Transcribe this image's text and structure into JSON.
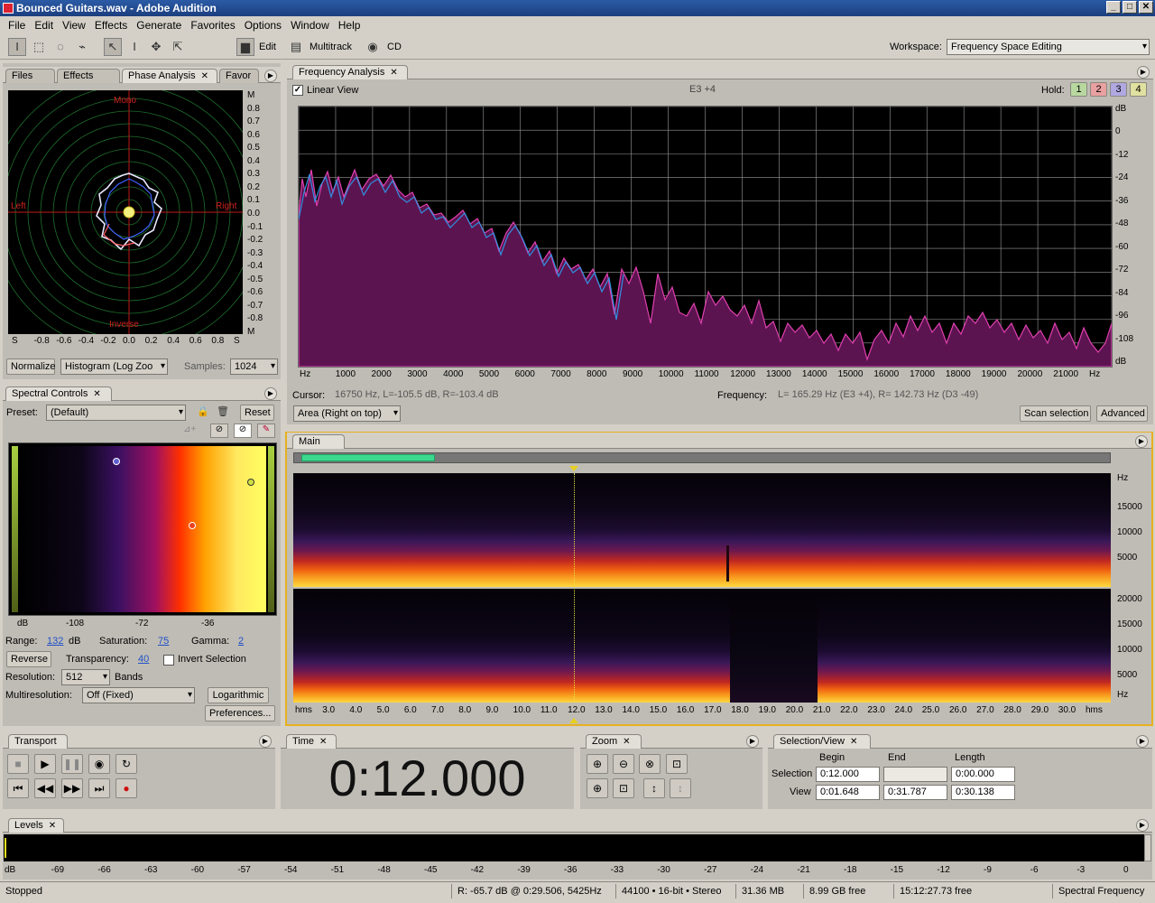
{
  "window": {
    "title": "Bounced Guitars.wav - Adobe Audition",
    "min": "_",
    "max": "□",
    "close": "✕"
  },
  "menu": [
    "File",
    "Edit",
    "View",
    "Effects",
    "Generate",
    "Favorites",
    "Options",
    "Window",
    "Help"
  ],
  "toolbar": {
    "edit": "Edit",
    "multitrack": "Multitrack",
    "cd": "CD",
    "workspace_label": "Workspace:",
    "workspace_value": "Frequency Space Editing"
  },
  "left_tabs": [
    "Files",
    "Effects",
    "Phase Analysis",
    "Favor"
  ],
  "phase": {
    "mono": "Mono",
    "inverse": "Inverse",
    "left": "Left",
    "right": "Right",
    "yticks": [
      "M",
      "0.8",
      "0.7",
      "0.6",
      "0.5",
      "0.4",
      "0.3",
      "0.2",
      "0.1",
      "0.0",
      "-0.1",
      "-0.2",
      "-0.3",
      "-0.4",
      "-0.5",
      "-0.6",
      "-0.7",
      "-0.8",
      "M"
    ],
    "xticks": [
      "S",
      "-0.8",
      "-0.6",
      "-0.4",
      "-0.2",
      "0.0",
      "0.2",
      "0.4",
      "0.6",
      "0.8",
      "S"
    ],
    "normalize": "Normalize",
    "histogram": "Histogram (Log Zoo",
    "samples_label": "Samples:",
    "samples": "1024"
  },
  "spectral": {
    "tab": "Spectral Controls",
    "preset_label": "Preset:",
    "preset": "(Default)",
    "reset": "Reset",
    "ticks": [
      "dB",
      "-108",
      "-72",
      "-36"
    ],
    "range_label": "Range:",
    "range": "132",
    "range_unit": "dB",
    "sat_label": "Saturation:",
    "sat": "75",
    "gamma_label": "Gamma:",
    "gamma": "2",
    "reverse": "Reverse",
    "transp_label": "Transparency:",
    "transp": "40",
    "invert": "Invert Selection",
    "res_label": "Resolution:",
    "res": "512",
    "bands": "Bands",
    "multires_label": "Multiresolution:",
    "multires": "Off (Fixed)",
    "log": "Logarithmic",
    "prefs": "Preferences..."
  },
  "freq": {
    "tab": "Frequency Analysis",
    "linear": "Linear View",
    "note": "E3 +4",
    "hold": "Hold:",
    "holds": [
      "1",
      "2",
      "3",
      "4"
    ],
    "hold_colors": [
      "#b8d8a0",
      "#e8a0a0",
      "#b0a8e0",
      "#e0e0a0"
    ],
    "dbticks": [
      "dB",
      "0",
      "-12",
      "-24",
      "-36",
      "-48",
      "-60",
      "-72",
      "-84",
      "-96",
      "-108",
      "dB"
    ],
    "xticks": [
      "Hz",
      "1000",
      "2000",
      "3000",
      "4000",
      "5000",
      "6000",
      "7000",
      "8000",
      "9000",
      "10000",
      "11000",
      "12000",
      "13000",
      "14000",
      "15000",
      "16000",
      "17000",
      "18000",
      "19000",
      "20000",
      "21000",
      "Hz"
    ],
    "cursor_label": "Cursor:",
    "cursor": "16750 Hz, L=-105.5 dB, R=-103.4 dB",
    "freq_label": "Frequency:",
    "freq": "L= 165.29 Hz (E3 +4), R= 142.73 Hz (D3 -49)",
    "area": "Area (Right on top)",
    "scan": "Scan selection",
    "advanced": "Advanced"
  },
  "main": {
    "tab": "Main",
    "hz_top": [
      "Hz",
      "15000",
      "10000",
      "5000"
    ],
    "hz_bot": [
      "20000",
      "15000",
      "10000",
      "5000",
      "Hz"
    ],
    "time": [
      "hms",
      "3.0",
      "4.0",
      "5.0",
      "6.0",
      "7.0",
      "8.0",
      "9.0",
      "10.0",
      "11.0",
      "12.0",
      "13.0",
      "14.0",
      "15.0",
      "16.0",
      "17.0",
      "18.0",
      "19.0",
      "20.0",
      "21.0",
      "22.0",
      "23.0",
      "24.0",
      "25.0",
      "26.0",
      "27.0",
      "28.0",
      "29.0",
      "30.0",
      "hms"
    ]
  },
  "transport": {
    "tab": "Transport"
  },
  "time": {
    "tab": "Time",
    "value": "0:12.000"
  },
  "zoom": {
    "tab": "Zoom"
  },
  "selection": {
    "tab": "Selection/View",
    "begin": "Begin",
    "end": "End",
    "length": "Length",
    "sel_label": "Selection",
    "view_label": "View",
    "sel_begin": "0:12.000",
    "sel_end": "",
    "sel_len": "0:00.000",
    "view_begin": "0:01.648",
    "view_end": "0:31.787",
    "view_len": "0:30.138"
  },
  "levels": {
    "tab": "Levels",
    "ticks": [
      "dB",
      "-69",
      "-66",
      "-63",
      "-60",
      "-57",
      "-54",
      "-51",
      "-48",
      "-45",
      "-42",
      "-39",
      "-36",
      "-33",
      "-30",
      "-27",
      "-24",
      "-21",
      "-18",
      "-15",
      "-12",
      "-9",
      "-6",
      "-3",
      "0"
    ]
  },
  "status": {
    "state": "Stopped",
    "r": "R: -65.7 dB @  0:29.506, 5425Hz",
    "fmt": "44100 • 16-bit • Stereo",
    "size": "31.36 MB",
    "free": "8.99 GB free",
    "time_free": "15:12:27.73 free",
    "view": "Spectral Frequency"
  }
}
